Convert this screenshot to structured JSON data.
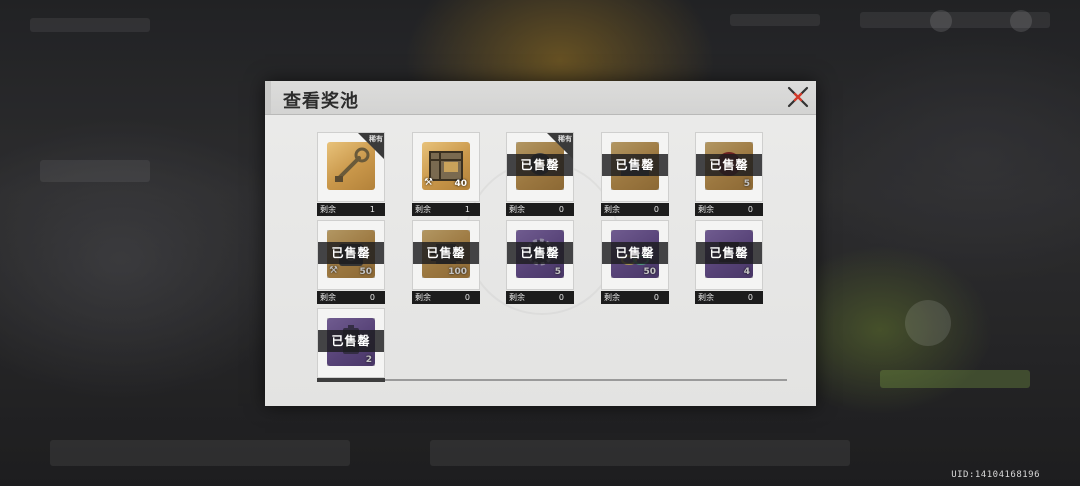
{
  "dialog": {
    "title": "查看奖池"
  },
  "remain_label": "剩余",
  "sold_label": "已售罄",
  "rare_label": "稀有",
  "uid": "UID:14104168196",
  "items": [
    {
      "id": "wrench-key",
      "icon": "wrench-key-icon",
      "rarity": "gold",
      "rare": true,
      "sold": false,
      "qty": "",
      "tool": false,
      "remain": "1"
    },
    {
      "id": "supply-crate",
      "icon": "crate-icon",
      "rarity": "gold",
      "rare": false,
      "sold": false,
      "qty": "40",
      "tool": true,
      "remain": "1"
    },
    {
      "id": "rare-part",
      "icon": "part-icon",
      "rarity": "gold",
      "rare": true,
      "sold": true,
      "qty": "",
      "tool": false,
      "remain": "0"
    },
    {
      "id": "gun-part",
      "icon": "gun-part-icon",
      "rarity": "gold",
      "rare": false,
      "sold": true,
      "qty": "",
      "tool": false,
      "remain": "0"
    },
    {
      "id": "red-core",
      "icon": "core-icon",
      "rarity": "gold",
      "rare": false,
      "sold": true,
      "qty": "5",
      "tool": false,
      "remain": "0"
    },
    {
      "id": "engine-part",
      "icon": "engine-icon",
      "rarity": "gold",
      "rare": false,
      "sold": true,
      "qty": "50",
      "tool": true,
      "remain": "0"
    },
    {
      "id": "gold-chip",
      "icon": "chip-icon",
      "rarity": "gold",
      "rare": false,
      "sold": true,
      "qty": "100",
      "tool": false,
      "remain": "0"
    },
    {
      "id": "purple-gear",
      "icon": "gear-icon",
      "rarity": "purple",
      "rare": false,
      "sold": true,
      "qty": "5",
      "tool": false,
      "remain": "0"
    },
    {
      "id": "purple-chain",
      "icon": "chain-icon",
      "rarity": "purple",
      "rare": false,
      "sold": true,
      "qty": "50",
      "tool": false,
      "remain": "0"
    },
    {
      "id": "purple-module",
      "icon": "module-icon",
      "rarity": "purple",
      "rare": false,
      "sold": true,
      "qty": "4",
      "tool": false,
      "remain": "0"
    },
    {
      "id": "purple-battery",
      "icon": "battery-icon",
      "rarity": "purple",
      "rare": false,
      "sold": true,
      "qty": "2",
      "tool": false,
      "remain": ""
    }
  ]
}
